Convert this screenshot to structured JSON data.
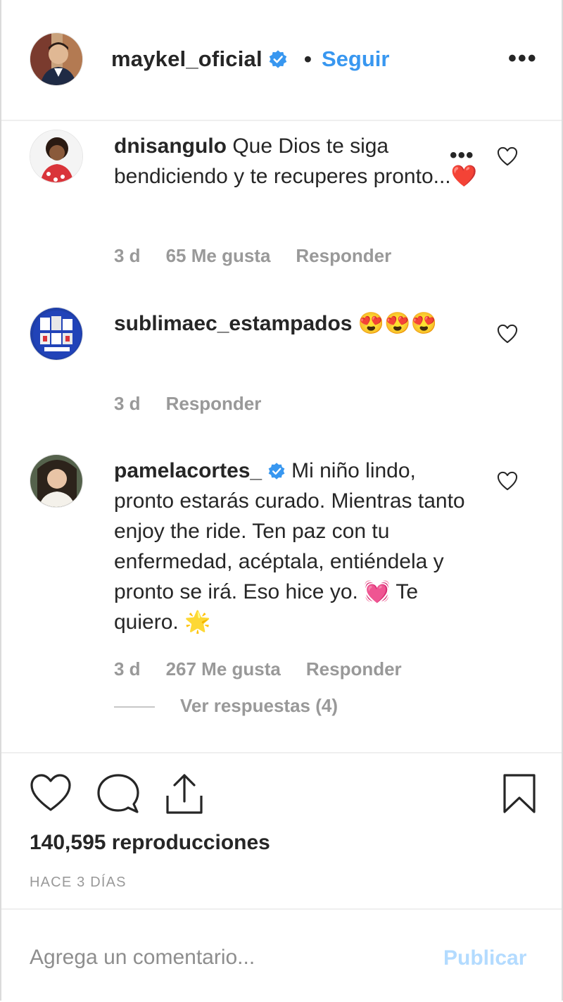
{
  "header": {
    "username": "maykel_oficial",
    "separator": "•",
    "follow_label": "Seguir",
    "more_label": "•••"
  },
  "comments": [
    {
      "username": "dnisangulo",
      "text": "Que Dios te siga bendiciendo y te recuperes pronto...",
      "emoji_after": "❤️",
      "time": "3 d",
      "likes": "65 Me gusta",
      "reply_label": "Responder",
      "more_label": "•••"
    },
    {
      "username": "sublimaec_estampados",
      "emoji_after": "😍😍😍",
      "time": "3 d",
      "reply_label": "Responder"
    },
    {
      "username": "pamelacortes_",
      "text": "Mi niño lindo, pronto estarás curado. Mientras tanto enjoy the ride. Ten paz con tu enfermedad, acéptala, entiéndela y pronto se irá. Eso hice yo.",
      "emoji_mid": "💓",
      "text_end": "Te quiero.",
      "emoji_end": "🌟",
      "time": "3 d",
      "likes": "267 Me gusta",
      "reply_label": "Responder",
      "view_replies": "Ver respuestas (4)"
    }
  ],
  "footer": {
    "views": "140,595 reproducciones",
    "posted_ago": "HACE 3 DÍAS"
  },
  "composer": {
    "placeholder": "Agrega un comentario...",
    "publish_label": "Publicar"
  },
  "colors": {
    "link": "#3897f0",
    "muted": "#999999",
    "publish_disabled": "#b3dbff",
    "verified": "#3897f0"
  },
  "icons": [
    "verified-badge-icon",
    "heart-icon",
    "comment-icon",
    "share-icon",
    "bookmark-icon",
    "more-options-icon"
  ]
}
